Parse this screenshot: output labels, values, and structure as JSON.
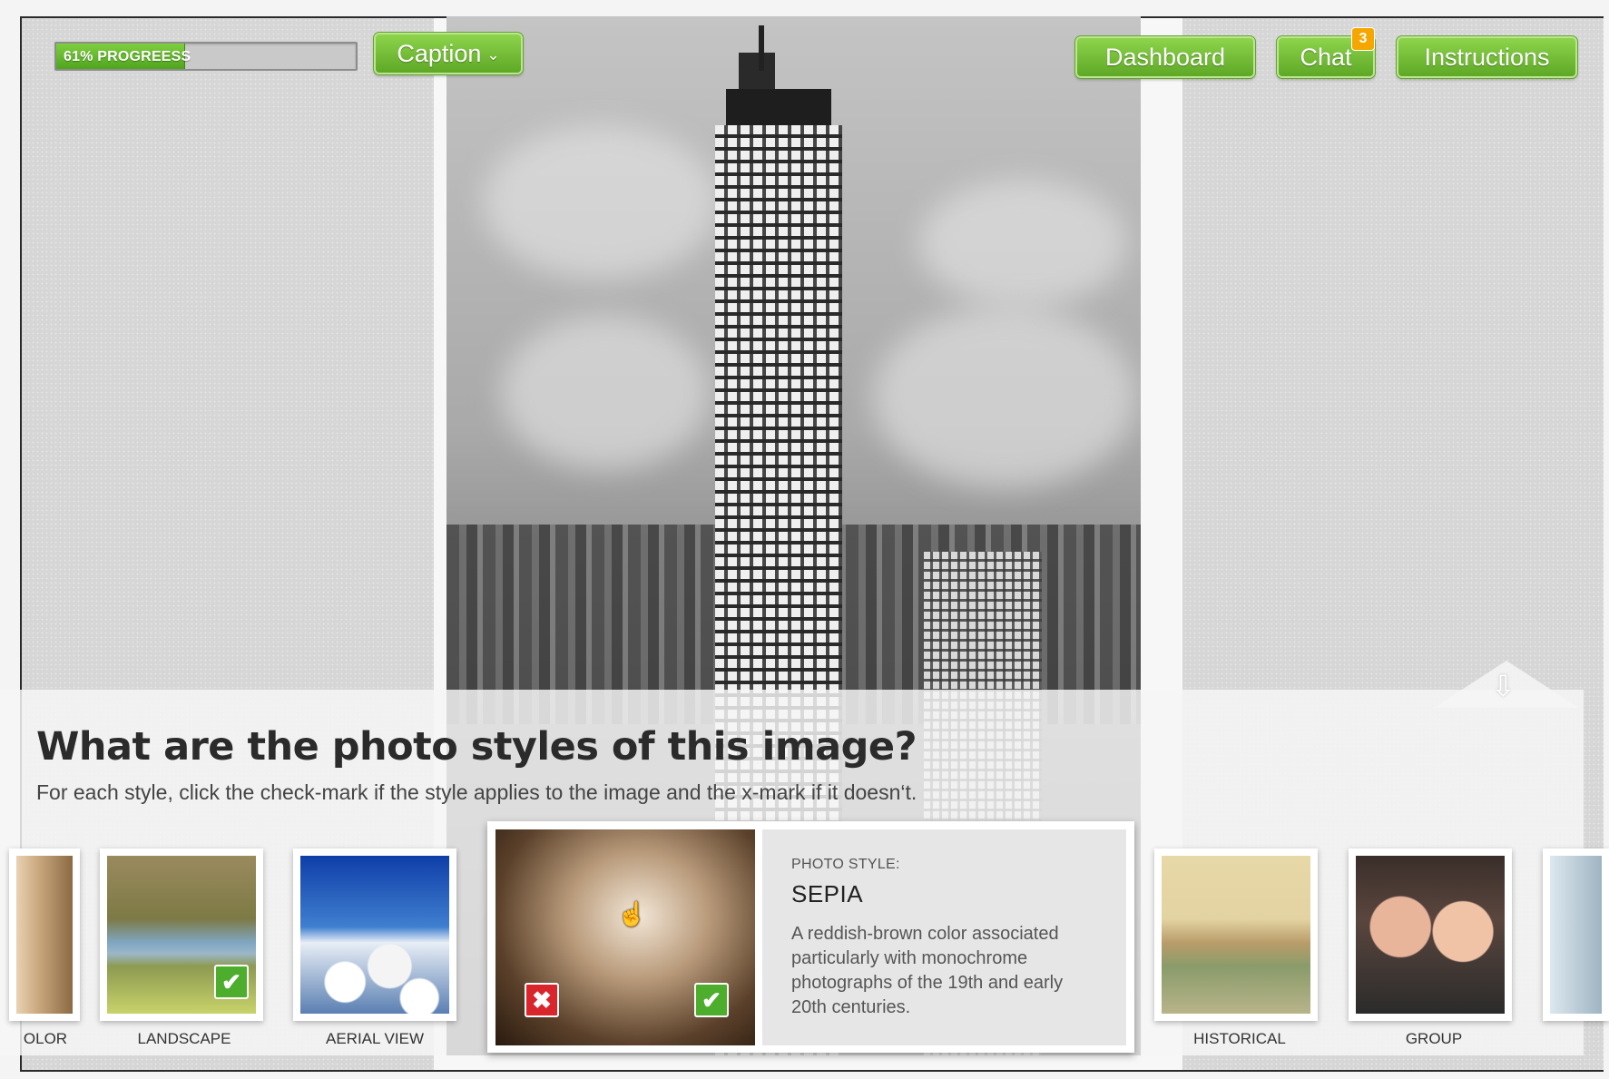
{
  "progress": {
    "label": "61% PROGREESS",
    "percent": 61
  },
  "nav": {
    "caption": "Caption",
    "dashboard": "Dashboard",
    "chat": "Chat",
    "chat_badge": "3",
    "instructions": "Instructions"
  },
  "question": {
    "title": "What are the photo styles of this image?",
    "subtitle": "For each style, click the check-mark if the style applies to the image and the x-mark if it doesn‘t."
  },
  "styles": [
    {
      "label": "COLOR",
      "visible_label": "OLOR"
    },
    {
      "label": "LANDSCAPE",
      "checked": true
    },
    {
      "label": "AERIAL VIEW"
    },
    {
      "label": "HISTORICAL"
    },
    {
      "label": "GROUP"
    }
  ],
  "selected_style": {
    "kicker": "PHOTO STYLE:",
    "name": "SEPIA",
    "description": "A reddish-brown color associated particularly with monochrome photographs of the 19th and early 20th centuries."
  },
  "icons": {
    "check": "checkmark-icon",
    "x": "x-mark-icon",
    "chevron": "chevron-down-icon",
    "down": "down-arrow-icon"
  },
  "colors": {
    "accent_green": "#5ea826",
    "badge_orange": "#f5a600",
    "reject_red": "#d9262c"
  }
}
